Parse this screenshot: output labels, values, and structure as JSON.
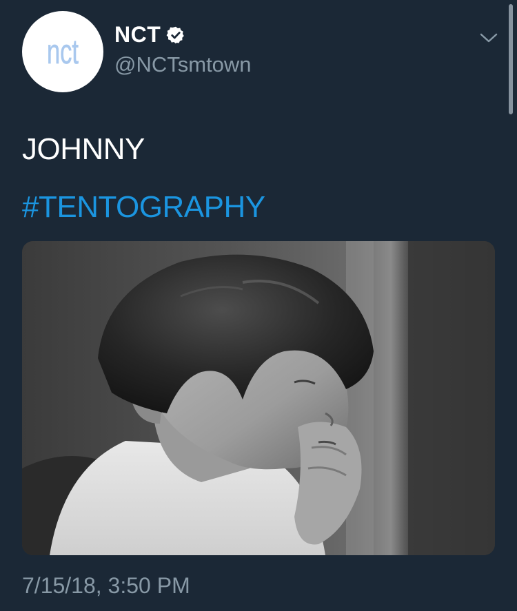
{
  "account": {
    "display_name": "NCT",
    "handle": "@NCTsmtown",
    "verified": true,
    "avatar_icon": "nct-logo-icon",
    "avatar_text": "nct"
  },
  "tweet": {
    "text": "JOHNNY",
    "hashtag": "#TENTOGRAPHY",
    "timestamp": "7/15/18, 3:50 PM"
  },
  "media": {
    "kind": "photo",
    "style": "black-and-white portrait"
  },
  "icons": {
    "verified": "verified-badge-icon",
    "menu": "chevron-down-icon"
  },
  "colors": {
    "background": "#1b2836",
    "text": "#ffffff",
    "secondary_text": "#8899a6",
    "link": "#1b95e0",
    "logo": "#a9c8ee"
  }
}
